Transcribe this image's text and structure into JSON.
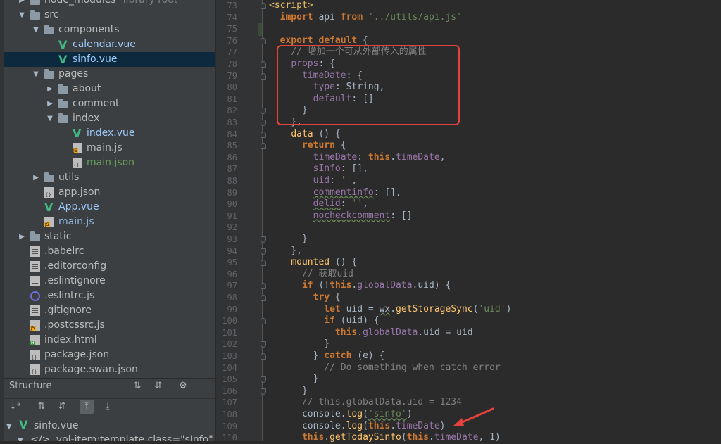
{
  "project_tree": [
    {
      "label": "node_modules",
      "hint": "library root",
      "indent": 2,
      "type": "folder",
      "arrow": "▶"
    },
    {
      "label": "src",
      "indent": 2,
      "type": "folder",
      "arrow": "▼"
    },
    {
      "label": "components",
      "indent": 3,
      "type": "folder",
      "arrow": "▼"
    },
    {
      "label": "calendar.vue",
      "indent": 4,
      "type": "vue"
    },
    {
      "label": "sinfo.vue",
      "indent": 4,
      "type": "vue",
      "selected": true
    },
    {
      "label": "pages",
      "indent": 3,
      "type": "folder",
      "arrow": "▼"
    },
    {
      "label": "about",
      "indent": 4,
      "type": "folder",
      "arrow": "▶"
    },
    {
      "label": "comment",
      "indent": 4,
      "type": "folder",
      "arrow": "▶"
    },
    {
      "label": "index",
      "indent": 4,
      "type": "folder",
      "arrow": "▼"
    },
    {
      "label": "index.vue",
      "indent": 5,
      "type": "vue"
    },
    {
      "label": "main.js",
      "indent": 5,
      "type": "js"
    },
    {
      "label": "main.json",
      "indent": 5,
      "type": "json",
      "labelClass": "c-json"
    },
    {
      "label": "utils",
      "indent": 3,
      "type": "folder",
      "arrow": "▶"
    },
    {
      "label": "app.json",
      "indent": 3,
      "type": "json"
    },
    {
      "label": "App.vue",
      "indent": 3,
      "type": "vue"
    },
    {
      "label": "main.js",
      "indent": 3,
      "type": "js",
      "labelClass": "c-js"
    },
    {
      "label": "static",
      "indent": 2,
      "type": "folder",
      "arrow": "▶"
    },
    {
      "label": ".babelrc",
      "indent": 2,
      "type": "file"
    },
    {
      "label": ".editorconfig",
      "indent": 2,
      "type": "file"
    },
    {
      "label": ".eslintignore",
      "indent": 2,
      "type": "file"
    },
    {
      "label": ".eslintrc.js",
      "indent": 2,
      "type": "eslint"
    },
    {
      "label": ".gitignore",
      "indent": 2,
      "type": "file"
    },
    {
      "label": ".postcssrc.js",
      "indent": 2,
      "type": "js"
    },
    {
      "label": "index.html",
      "indent": 2,
      "type": "html"
    },
    {
      "label": "package.json",
      "indent": 2,
      "type": "json"
    },
    {
      "label": "package.swan.json",
      "indent": 2,
      "type": "json"
    }
  ],
  "structure": {
    "title": "Structure",
    "root": "sinfo.vue",
    "child": "vol-item:template  class=\"sInfo\""
  },
  "editor": {
    "line_numbers": [
      "73",
      "74",
      "75",
      "76",
      "77",
      "78",
      "79",
      "80",
      "81",
      "82",
      "83",
      "84",
      "85",
      "86",
      "87",
      "88",
      "89",
      "90",
      "91",
      "92",
      "93",
      "94",
      "95",
      "96",
      "97",
      "98",
      "99",
      "100",
      "101",
      "102",
      "103",
      "104",
      "105",
      "106",
      "107",
      "108",
      "109",
      "110"
    ],
    "lines": [
      [
        {
          "t": "tag",
          "v": "<script>"
        }
      ],
      [
        {
          "t": "",
          "v": "  "
        },
        {
          "t": "kw",
          "v": "import"
        },
        {
          "t": "",
          "v": " api "
        },
        {
          "t": "kw",
          "v": "from"
        },
        {
          "t": "",
          "v": " "
        },
        {
          "t": "str",
          "v": "'../utils/api.js'"
        }
      ],
      [],
      [
        {
          "t": "",
          "v": "  "
        },
        {
          "t": "kw",
          "v": "export default"
        },
        {
          "t": "",
          "v": " {"
        }
      ],
      [
        {
          "t": "",
          "v": "    "
        },
        {
          "t": "cmt",
          "v": "// 增加一个可从外部传入的属性"
        }
      ],
      [
        {
          "t": "",
          "v": "    "
        },
        {
          "t": "prop",
          "v": "props"
        },
        {
          "t": "",
          "v": ": {"
        }
      ],
      [
        {
          "t": "",
          "v": "      "
        },
        {
          "t": "prop",
          "v": "timeDate"
        },
        {
          "t": "",
          "v": ": {"
        }
      ],
      [
        {
          "t": "",
          "v": "        "
        },
        {
          "t": "prop",
          "v": "type"
        },
        {
          "t": "",
          "v": ": String,"
        }
      ],
      [
        {
          "t": "",
          "v": "        "
        },
        {
          "t": "prop",
          "v": "default"
        },
        {
          "t": "",
          "v": ": []"
        }
      ],
      [
        {
          "t": "",
          "v": "      }"
        }
      ],
      [
        {
          "t": "",
          "v": "    },"
        }
      ],
      [
        {
          "t": "",
          "v": "    "
        },
        {
          "t": "fn",
          "v": "data"
        },
        {
          "t": "",
          "v": " () {"
        }
      ],
      [
        {
          "t": "",
          "v": "      "
        },
        {
          "t": "kw",
          "v": "return"
        },
        {
          "t": "",
          "v": " {"
        }
      ],
      [
        {
          "t": "",
          "v": "        "
        },
        {
          "t": "prop",
          "v": "timeDate"
        },
        {
          "t": "",
          "v": ": "
        },
        {
          "t": "kw",
          "v": "this"
        },
        {
          "t": "",
          "v": "."
        },
        {
          "t": "prop",
          "v": "timeDate"
        },
        {
          "t": "",
          "v": ","
        }
      ],
      [
        {
          "t": "",
          "v": "        "
        },
        {
          "t": "prop",
          "v": "sInfo"
        },
        {
          "t": "",
          "v": ": [],"
        }
      ],
      [
        {
          "t": "",
          "v": "        "
        },
        {
          "t": "prop",
          "v": "uid"
        },
        {
          "t": "",
          "v": ": "
        },
        {
          "t": "str",
          "v": "''"
        },
        {
          "t": "",
          "v": ","
        }
      ],
      [
        {
          "t": "",
          "v": "        "
        },
        {
          "t": "prop sq",
          "v": "commentinfo"
        },
        {
          "t": "",
          "v": ": [],"
        }
      ],
      [
        {
          "t": "",
          "v": "        "
        },
        {
          "t": "prop sq",
          "v": "delid"
        },
        {
          "t": "",
          "v": ": "
        },
        {
          "t": "str",
          "v": "''"
        },
        {
          "t": "",
          "v": ","
        }
      ],
      [
        {
          "t": "",
          "v": "        "
        },
        {
          "t": "prop sq",
          "v": "nocheckcomment"
        },
        {
          "t": "",
          "v": ": []"
        }
      ],
      [],
      [
        {
          "t": "",
          "v": "      }"
        }
      ],
      [
        {
          "t": "",
          "v": "    },"
        }
      ],
      [
        {
          "t": "",
          "v": "    "
        },
        {
          "t": "fn",
          "v": "mounted"
        },
        {
          "t": "",
          "v": " () {"
        }
      ],
      [
        {
          "t": "",
          "v": "      "
        },
        {
          "t": "cmt",
          "v": "// 获取uid"
        }
      ],
      [
        {
          "t": "",
          "v": "      "
        },
        {
          "t": "kw",
          "v": "if"
        },
        {
          "t": "",
          "v": " (!"
        },
        {
          "t": "kw",
          "v": "this"
        },
        {
          "t": "",
          "v": "."
        },
        {
          "t": "prop",
          "v": "globalData"
        },
        {
          "t": "",
          "v": ".uid) {"
        }
      ],
      [
        {
          "t": "",
          "v": "        "
        },
        {
          "t": "kw",
          "v": "try"
        },
        {
          "t": "",
          "v": " {"
        }
      ],
      [
        {
          "t": "",
          "v": "          "
        },
        {
          "t": "kw",
          "v": "let"
        },
        {
          "t": "",
          "v": " uid = "
        },
        {
          "t": "sq",
          "v": "wx"
        },
        {
          "t": "",
          "v": "."
        },
        {
          "t": "fn",
          "v": "getStorageSync"
        },
        {
          "t": "",
          "v": "("
        },
        {
          "t": "str",
          "v": "'uid'"
        },
        {
          "t": "",
          "v": ")"
        }
      ],
      [
        {
          "t": "",
          "v": "          "
        },
        {
          "t": "kw",
          "v": "if"
        },
        {
          "t": "",
          "v": " (uid) {"
        }
      ],
      [
        {
          "t": "",
          "v": "            "
        },
        {
          "t": "kw",
          "v": "this"
        },
        {
          "t": "",
          "v": "."
        },
        {
          "t": "prop",
          "v": "globalData"
        },
        {
          "t": "",
          "v": ".uid = uid"
        }
      ],
      [
        {
          "t": "",
          "v": "          }"
        }
      ],
      [
        {
          "t": "",
          "v": "        } "
        },
        {
          "t": "kw",
          "v": "catch"
        },
        {
          "t": "",
          "v": " (e) {"
        }
      ],
      [
        {
          "t": "",
          "v": "          "
        },
        {
          "t": "cmt",
          "v": "// Do something when catch error"
        }
      ],
      [
        {
          "t": "",
          "v": "        }"
        }
      ],
      [
        {
          "t": "",
          "v": "      }"
        }
      ],
      [
        {
          "t": "",
          "v": "      "
        },
        {
          "t": "cmt",
          "v": "// this.globalData.uid = 1234"
        }
      ],
      [
        {
          "t": "",
          "v": "      console."
        },
        {
          "t": "fn",
          "v": "log"
        },
        {
          "t": "",
          "v": "("
        },
        {
          "t": "str sq",
          "v": "'sinfo'"
        },
        {
          "t": "",
          "v": ")"
        }
      ],
      [
        {
          "t": "",
          "v": "      console."
        },
        {
          "t": "fn",
          "v": "log"
        },
        {
          "t": "",
          "v": "("
        },
        {
          "t": "kw",
          "v": "this"
        },
        {
          "t": "",
          "v": "."
        },
        {
          "t": "prop",
          "v": "timeDate"
        },
        {
          "t": "",
          "v": ")"
        }
      ],
      [
        {
          "t": "",
          "v": "      "
        },
        {
          "t": "kw",
          "v": "this"
        },
        {
          "t": "",
          "v": "."
        },
        {
          "t": "fn",
          "v": "getTodaySinfo"
        },
        {
          "t": "",
          "v": "("
        },
        {
          "t": "kw",
          "v": "this"
        },
        {
          "t": "",
          "v": "."
        },
        {
          "t": "prop",
          "v": "timeDate"
        },
        {
          "t": "",
          "v": ", 1)"
        }
      ]
    ]
  },
  "colors": {
    "highlight_box": "#e3423d",
    "arrow": "#e3423d"
  }
}
